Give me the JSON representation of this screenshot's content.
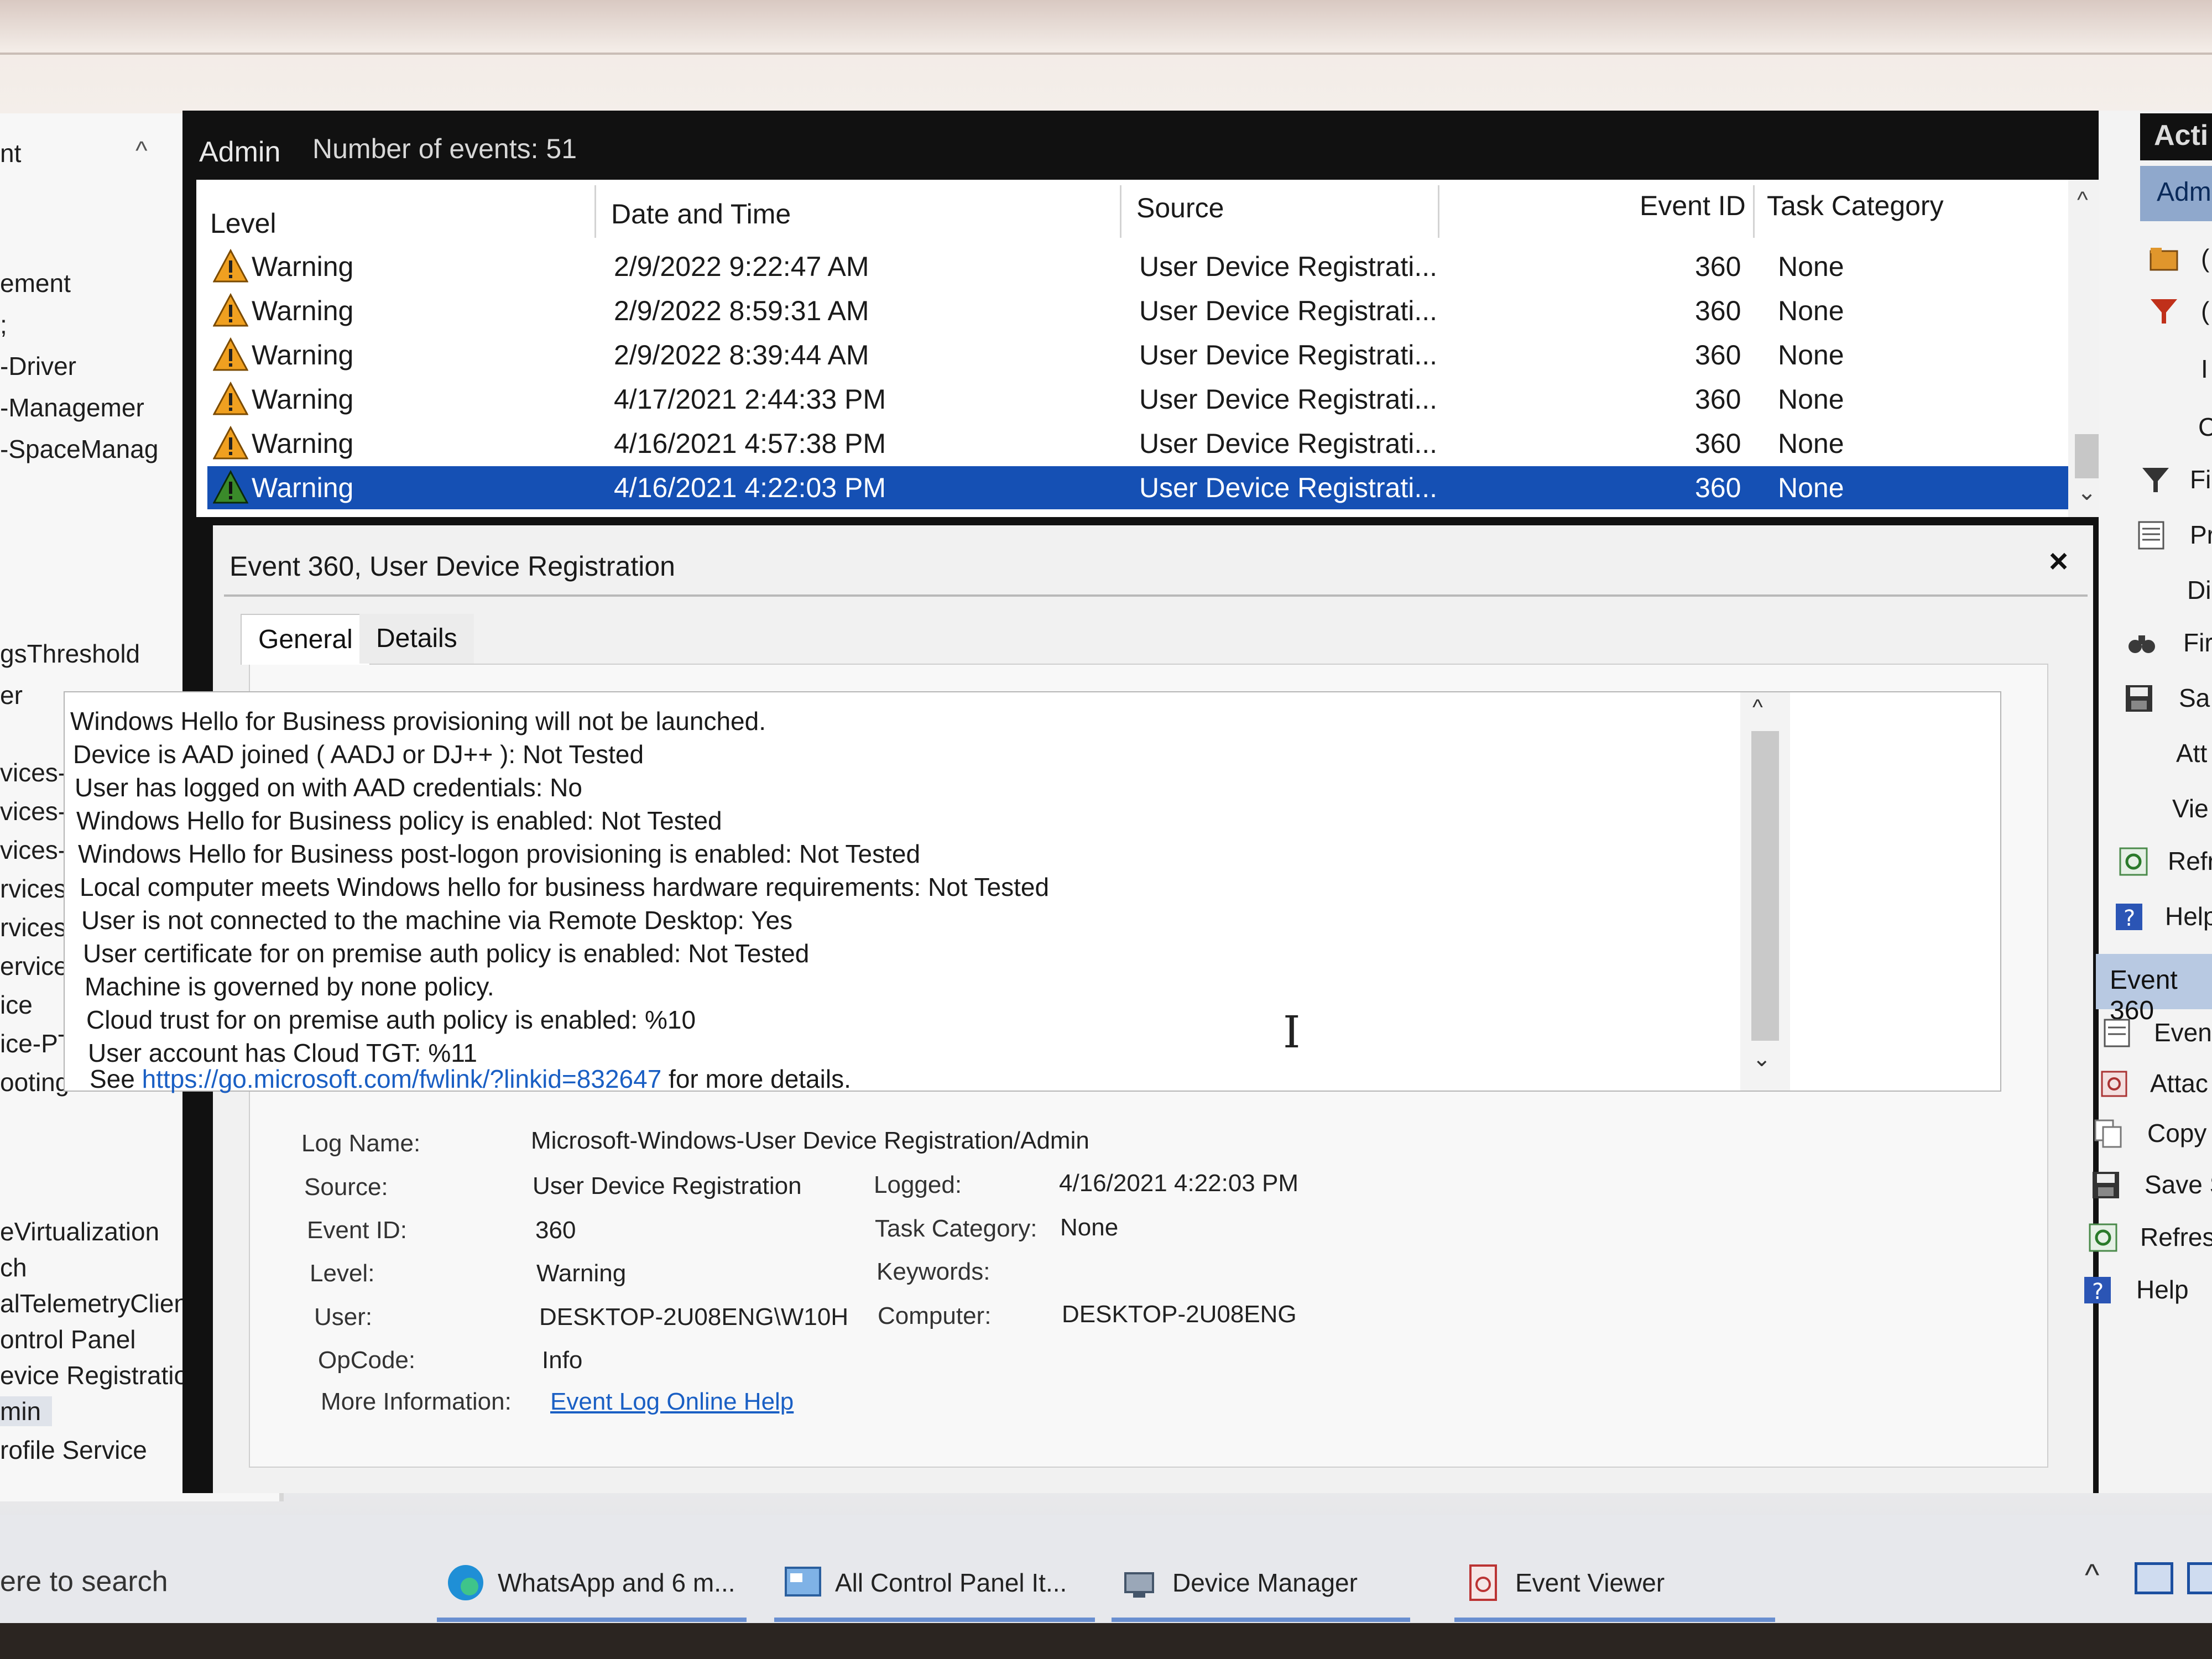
{
  "header": {
    "title": "Admin",
    "count": "Number of events: 51"
  },
  "tree": {
    "items": [
      "nt",
      "ement",
      ";",
      "-Driver",
      "-Managemer",
      "-SpaceManag",
      "gsThreshold",
      "er",
      "vices-ClientActi",
      "vices-ClientUSB",
      "vices-LocalSessi",
      "rvices-PnPDevice",
      "rvices-Printers",
      "ervices-RemoteCc",
      "ice",
      "ice-PTP-Provider",
      "ooting-Recomme",
      "eVirtualization",
      "ch",
      "alTelemetryClient",
      "ontrol Panel",
      "evice Registration",
      "min",
      "rofile Service"
    ]
  },
  "grid": {
    "columns": [
      "Level",
      "Date and Time",
      "Source",
      "Event ID",
      "Task Category"
    ],
    "rows": [
      {
        "level": "Warning",
        "datetime": "2/9/2022 9:22:47 AM",
        "source": "User Device Registrati...",
        "event_id": "360",
        "task": "None"
      },
      {
        "level": "Warning",
        "datetime": "2/9/2022 8:59:31 AM",
        "source": "User Device Registrati...",
        "event_id": "360",
        "task": "None"
      },
      {
        "level": "Warning",
        "datetime": "2/9/2022 8:39:44 AM",
        "source": "User Device Registrati...",
        "event_id": "360",
        "task": "None"
      },
      {
        "level": "Warning",
        "datetime": "4/17/2021 2:44:33 PM",
        "source": "User Device Registrati...",
        "event_id": "360",
        "task": "None"
      },
      {
        "level": "Warning",
        "datetime": "4/16/2021 4:57:38 PM",
        "source": "User Device Registrati...",
        "event_id": "360",
        "task": "None"
      },
      {
        "level": "Warning",
        "datetime": "4/16/2021 4:22:03 PM",
        "source": "User Device Registrati...",
        "event_id": "360",
        "task": "None"
      }
    ]
  },
  "details": {
    "title": "Event 360, User Device Registration",
    "close": "×",
    "tabs": [
      "General",
      "Details"
    ],
    "description": [
      "Windows Hello for Business provisioning will not be launched.",
      "Device is AAD joined ( AADJ or DJ++ ): Not Tested",
      "User has logged on with AAD credentials: No",
      "Windows Hello for Business policy is enabled: Not Tested",
      "Windows Hello for Business post-logon provisioning is enabled: Not Tested",
      "Local computer meets Windows hello for business hardware requirements: Not Tested",
      "User is not connected to the machine via Remote Desktop: Yes",
      "User certificate for on premise auth policy is enabled: Not Tested",
      "Machine is governed by none policy.",
      "Cloud trust for on premise auth policy is enabled: %10",
      "User account has Cloud TGT: %11"
    ],
    "see_prefix": "See ",
    "see_link": "https://go.microsoft.com/fwlink/?linkid=832647",
    "see_suffix": " for more details.",
    "props": {
      "log_name_label": "Log Name:",
      "log_name": "Microsoft-Windows-User Device Registration/Admin",
      "source_label": "Source:",
      "source": "User Device Registration",
      "logged_label": "Logged:",
      "logged": "4/16/2021 4:22:03 PM",
      "event_id_label": "Event ID:",
      "event_id": "360",
      "task_label": "Task Category:",
      "task": "None",
      "level_label": "Level:",
      "level": "Warning",
      "keywords_label": "Keywords:",
      "keywords": "",
      "user_label": "User:",
      "user": "DESKTOP-2U08ENG\\W10H",
      "computer_label": "Computer:",
      "computer": "DESKTOP-2U08ENG",
      "opcode_label": "OpCode:",
      "opcode": "Info",
      "more_info_label": "More Information:",
      "more_info_link": "Event Log Online Help"
    }
  },
  "actions": {
    "title": "Acti",
    "sub": "Adm",
    "items": [
      "(",
      "(",
      "I",
      "C",
      "Fi",
      "Pr",
      "Di",
      "Fir",
      "Sa",
      "Att",
      "Vie",
      "Refr",
      "Help"
    ],
    "event_band": "Event 360",
    "event_items": [
      "Even",
      "Attac",
      "Copy",
      "Save S",
      "Refres",
      "Help"
    ]
  },
  "taskbar": {
    "search": "ere to search",
    "apps": [
      "WhatsApp and 6 m...",
      "All Control Panel It...",
      "Device Manager",
      "Event Viewer"
    ]
  },
  "colors": {
    "selection": "#1550b4",
    "warning": "#f0a020",
    "link": "#1a5fc4"
  }
}
